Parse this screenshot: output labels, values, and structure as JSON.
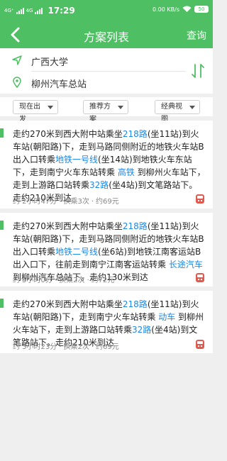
{
  "status_bar": {
    "signal_1": "4G⁺",
    "signal_2": "4G",
    "time": "17:29",
    "speed": "0.00 KB/s",
    "battery": "50"
  },
  "header": {
    "title": "方案列表",
    "action": "查询"
  },
  "route": {
    "origin": "广西大学",
    "destination": "柳州汽车总站"
  },
  "filters": {
    "time": "现在出发",
    "plan": "推荐方案",
    "view": "经典视图"
  },
  "plans": [
    {
      "segments": [
        {
          "text": "走约270米到西大附中站乘坐",
          "highlight": false
        },
        {
          "text": "218路",
          "highlight": true
        },
        {
          "text": "(坐11站)到火车站(朝阳路)下，走到马路同侧附近的地铁火车站B出入口转乘",
          "highlight": false
        },
        {
          "text": "地铁一号线",
          "highlight": true
        },
        {
          "text": "(坐14站)到地铁火车东站下，走到南宁火车东站转乘 ",
          "highlight": false
        },
        {
          "text": "高铁",
          "highlight": true
        },
        {
          "text": " 到柳州火车站下，走到上游路口站转乘",
          "highlight": false
        },
        {
          "text": "32路",
          "highlight": true
        },
        {
          "text": "(坐4站)到文笔路站下。走约210米到达",
          "highlight": false
        }
      ],
      "duration": "约 2小时47分",
      "transfers": "换乘3次",
      "price": "约69元"
    },
    {
      "segments": [
        {
          "text": "走约270米到西大附中站乘坐",
          "highlight": false
        },
        {
          "text": "218路",
          "highlight": true
        },
        {
          "text": "(坐11站)到火车站(朝阳路)下，走到马路同侧附近的地铁火车站B出入口转乘",
          "highlight": false
        },
        {
          "text": "地铁二号线",
          "highlight": true
        },
        {
          "text": "(坐6站)到地铁江南客运站B出入口下，往前走到南宁江南客运站转乘 ",
          "highlight": false
        },
        {
          "text": "长途汽车",
          "highlight": true
        },
        {
          "text": " 到柳州汽车总站下。走约130米到达",
          "highlight": false
        }
      ],
      "duration": "约 5小时0分",
      "transfers": "换乘2次",
      "price": "约72元"
    },
    {
      "segments": [
        {
          "text": "走约270米到西大附中站乘坐",
          "highlight": false
        },
        {
          "text": "218路",
          "highlight": true
        },
        {
          "text": "(坐11站)到火车站(朝阳路)下，走到南宁火车站转乘 ",
          "highlight": false
        },
        {
          "text": "动车",
          "highlight": true
        },
        {
          "text": " 到柳州火车站下，走到上游路口站转乘",
          "highlight": false
        },
        {
          "text": "32路",
          "highlight": true
        },
        {
          "text": "(坐4站)到文笔路站下。走约210米到达",
          "highlight": false
        }
      ],
      "duration": "约 3小时23分",
      "transfers": "换乘2次",
      "price": "约69元"
    }
  ],
  "dot": "·",
  "colors": {
    "brand": "#4fbf63",
    "link": "#1e88e5",
    "rail_icon": "#e05a4f"
  }
}
